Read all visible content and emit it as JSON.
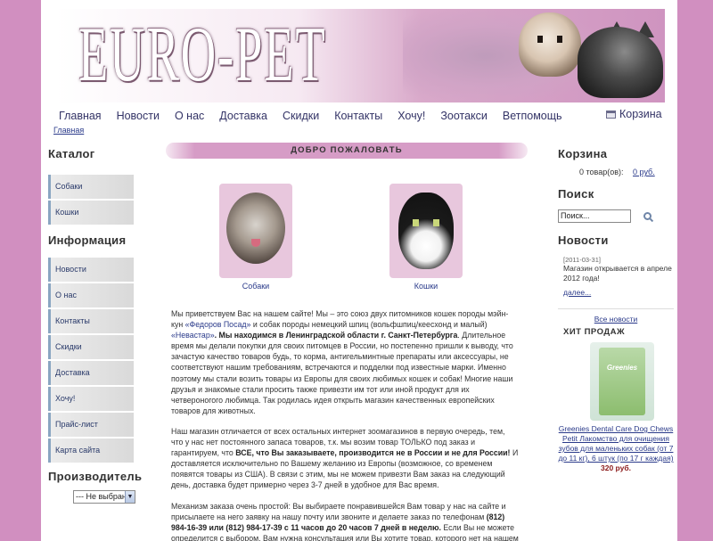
{
  "site": {
    "logo": "EURO-PET"
  },
  "nav": {
    "items": [
      "Главная",
      "Новости",
      "О нас",
      "Доставка",
      "Скидки",
      "Контакты",
      "Хочу!",
      "Зоотакси",
      "Ветпомощь"
    ],
    "cart": "Корзина"
  },
  "breadcrumb": "Главная",
  "left": {
    "catalog_title": "Каталог",
    "catalog": [
      "Собаки",
      "Кошки"
    ],
    "info_title": "Информация",
    "info": [
      "Новости",
      "О нас",
      "Контакты",
      "Скидки",
      "Доставка",
      "Хочу!",
      "Прайс-лист",
      "Карта сайта"
    ],
    "maker_title": "Производитель",
    "maker_select": "--- Не выбран"
  },
  "center": {
    "welcome": "ДОБРО ПОЖАЛОВАТЬ",
    "dogs_caption": "Собаки",
    "cats_caption": "Кошки",
    "p1_a": "Мы приветствуем Вас на нашем сайте! Мы – это союз двух питомников кошек породы мэйн-кун ",
    "p1_link1": "«Федоров Посад»",
    "p1_b": " и собак породы немецкий шпиц (вольфшпиц/кеесхонд и малый) ",
    "p1_link2": "«Невастар»",
    "p1_bold": ". Мы находимся в Ленинградской области г. Санкт-Петербурга",
    "p1_c": ". Длительное время мы делали покупки для своих питомцев в России, но постепенно пришли к выводу, что зачастую качество товаров будь, то корма, антигельминтные препараты или аксессуары, не соответствуют нашим требованиям, встречаются и подделки под известные марки. Именно поэтому мы стали возить товары из Европы для своих любимых кошек и собак! Многие наши друзья и знакомые стали просить также привезти им тот или иной продукт для их четвероногого любимца. Так родилась идея открыть магазин качественных европейских товаров для животных.",
    "p2_a": " Наш магазин отличается от всех остальных интернет зоомагазинов в первую очередь, тем, что у нас нет постоянного запаса товаров, т.к. мы возим товар ТОЛЬКО под заказ и гарантируем, что ",
    "p2_bold": "ВСЕ, что Вы заказываете, производится не в России и не для России!",
    "p2_b": " И доставляется исключительно по Вашему желанию из Европы (возможное, со временем появятся товары из США). В связи с этим, мы не можем привезти Вам заказ на следующий день, доставка будет примерно через 3-7 дней в удобное для Вас время.",
    "p3_a": "Механизм заказа очень простой: Вы выбираете понравившейся Вам товар у нас на сайте и присылаете на него заявку на нашу почту или звоните и делаете заказ по телефонам ",
    "p3_bold": "(812) 984-16-39 или (812) 984-17-39 с 11 часов до 20 часов 7 дней в неделю.",
    "p3_b": " Если Вы не можете определится с выбором, Вам нужна консультация или Вы хотите товар, которого нет на нашем сайте, также звоните или пишите нам и мы решим Ваш  вопрос."
  },
  "right": {
    "cart_title": "Корзина",
    "cart_items": "0 товар(ов):",
    "cart_sum": "0 руб.",
    "search_title": "Поиск",
    "search_value": "Поиск...",
    "news_title": "Новости",
    "news_date": "[2011-03-31]",
    "news_text": "Магазин открывается в апреле 2012 года!",
    "news_more": "далее...",
    "all_news": "Все новости",
    "hit_title": "ХИТ ПРОДАЖ",
    "product_brand": "Greenies",
    "product_name": "Greenies Dental Care Dog Chews Petit Лакомство для очищения зубов для маленьких собак (от 7 до 11 кг), 6 штук (по 17 г каждая)",
    "product_price": "320 руб."
  }
}
